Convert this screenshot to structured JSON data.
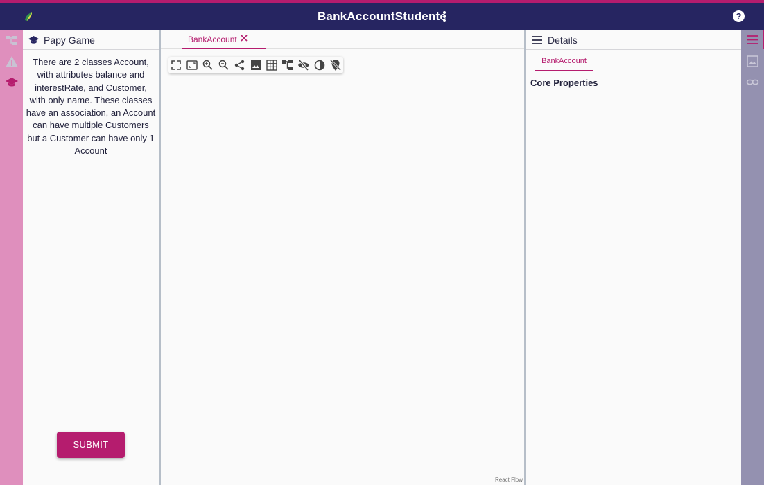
{
  "header": {
    "title": "BankAccountStudente",
    "help_label": "?"
  },
  "left_panel": {
    "title": "Papy Game",
    "prompt": "There are 2 classes Account, with attributes balance and interestRate, and Customer, with only name. These classes have an association, an Account can have multiple Customers but a Customer can have only 1 Account",
    "submit_label": "SUBMIT"
  },
  "canvas": {
    "tab_label": "BankAccount",
    "attribution": "React Flow",
    "toolbar_icons": [
      "fullscreen-icon",
      "fit-view-icon",
      "zoom-in-icon",
      "zoom-out-icon",
      "share-icon",
      "image-icon",
      "grid-icon",
      "hierarchy-icon",
      "visibility-off-icon",
      "contrast-icon",
      "location-off-icon"
    ]
  },
  "details": {
    "title": "Details",
    "tab_label": "BankAccount",
    "section_title": "Core Properties"
  },
  "colors": {
    "header_bg": "#262561",
    "accent": "#b51c6e",
    "left_rail": "#df8fbd",
    "right_rail": "#9491b0"
  }
}
